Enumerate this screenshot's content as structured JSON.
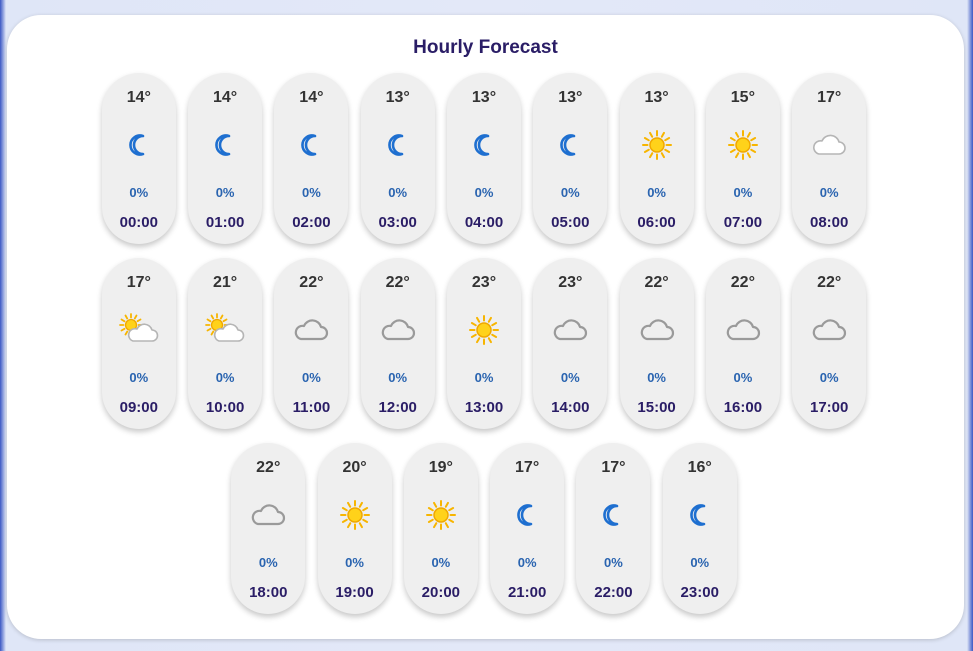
{
  "forecast": {
    "title": "Hourly Forecast",
    "hours": [
      {
        "temp": "14°",
        "icon": "moon-icon",
        "precip": "0%",
        "time": "00:00"
      },
      {
        "temp": "14°",
        "icon": "moon-icon",
        "precip": "0%",
        "time": "01:00"
      },
      {
        "temp": "14°",
        "icon": "moon-icon",
        "precip": "0%",
        "time": "02:00"
      },
      {
        "temp": "13°",
        "icon": "moon-icon",
        "precip": "0%",
        "time": "03:00"
      },
      {
        "temp": "13°",
        "icon": "moon-icon",
        "precip": "0%",
        "time": "04:00"
      },
      {
        "temp": "13°",
        "icon": "moon-icon",
        "precip": "0%",
        "time": "05:00"
      },
      {
        "temp": "13°",
        "icon": "sun-icon",
        "precip": "0%",
        "time": "06:00"
      },
      {
        "temp": "15°",
        "icon": "sun-icon",
        "precip": "0%",
        "time": "07:00"
      },
      {
        "temp": "17°",
        "icon": "cloud-icon",
        "precip": "0%",
        "time": "08:00"
      },
      {
        "temp": "17°",
        "icon": "partly-cloudy-icon",
        "precip": "0%",
        "time": "09:00"
      },
      {
        "temp": "21°",
        "icon": "partly-cloudy-icon",
        "precip": "0%",
        "time": "10:00"
      },
      {
        "temp": "22°",
        "icon": "overcast-cloud-icon",
        "precip": "0%",
        "time": "11:00"
      },
      {
        "temp": "22°",
        "icon": "overcast-cloud-icon",
        "precip": "0%",
        "time": "12:00"
      },
      {
        "temp": "23°",
        "icon": "sun-icon",
        "precip": "0%",
        "time": "13:00"
      },
      {
        "temp": "23°",
        "icon": "overcast-cloud-icon",
        "precip": "0%",
        "time": "14:00"
      },
      {
        "temp": "22°",
        "icon": "overcast-cloud-icon",
        "precip": "0%",
        "time": "15:00"
      },
      {
        "temp": "22°",
        "icon": "overcast-cloud-icon",
        "precip": "0%",
        "time": "16:00"
      },
      {
        "temp": "22°",
        "icon": "overcast-cloud-icon",
        "precip": "0%",
        "time": "17:00"
      },
      {
        "temp": "22°",
        "icon": "overcast-cloud-icon",
        "precip": "0%",
        "time": "18:00"
      },
      {
        "temp": "20°",
        "icon": "sun-icon",
        "precip": "0%",
        "time": "19:00"
      },
      {
        "temp": "19°",
        "icon": "sun-icon",
        "precip": "0%",
        "time": "20:00"
      },
      {
        "temp": "17°",
        "icon": "moon-icon",
        "precip": "0%",
        "time": "21:00"
      },
      {
        "temp": "17°",
        "icon": "moon-icon",
        "precip": "0%",
        "time": "22:00"
      },
      {
        "temp": "16°",
        "icon": "moon-icon",
        "precip": "0%",
        "time": "23:00"
      }
    ]
  },
  "colors": {
    "title": "#2a1d66",
    "precip": "#2a64b0",
    "moon": "#1e6fd0",
    "sun": "#f7b500",
    "cloud": "#9a9a9a"
  }
}
